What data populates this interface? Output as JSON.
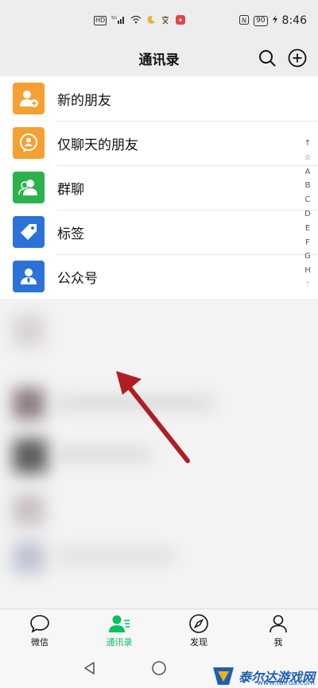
{
  "status_bar": {
    "network_badge": "HD",
    "signal_label": "5G",
    "nfc_label": "N",
    "battery": "90",
    "time": "8:46"
  },
  "header": {
    "title": "通讯录"
  },
  "list": {
    "items": [
      {
        "label": "新的朋友",
        "color": "#f5a033",
        "icon": "add-friend-icon"
      },
      {
        "label": "仅聊天的朋友",
        "color": "#f5a033",
        "icon": "chat-only-friend-icon"
      },
      {
        "label": "群聊",
        "color": "#2bb24c",
        "icon": "group-chat-icon"
      },
      {
        "label": "标签",
        "color": "#2b72d6",
        "icon": "tag-icon"
      },
      {
        "label": "公众号",
        "color": "#2b72d6",
        "icon": "official-account-icon"
      }
    ]
  },
  "index_bar": [
    "↑",
    "☆",
    "A",
    "B",
    "C",
    "D",
    "E",
    "F",
    "G",
    "H",
    "↑"
  ],
  "tabbar": {
    "tabs": [
      {
        "label": "微信",
        "icon": "chat-bubble-icon"
      },
      {
        "label": "通讯录",
        "icon": "contacts-icon"
      },
      {
        "label": "发现",
        "icon": "compass-icon"
      },
      {
        "label": "我",
        "icon": "person-icon"
      }
    ]
  },
  "watermark": {
    "name": "泰尔达游戏网",
    "url": "www.tairda.com"
  },
  "colors": {
    "accent": "#07c160",
    "arrow": "#b01e23"
  }
}
